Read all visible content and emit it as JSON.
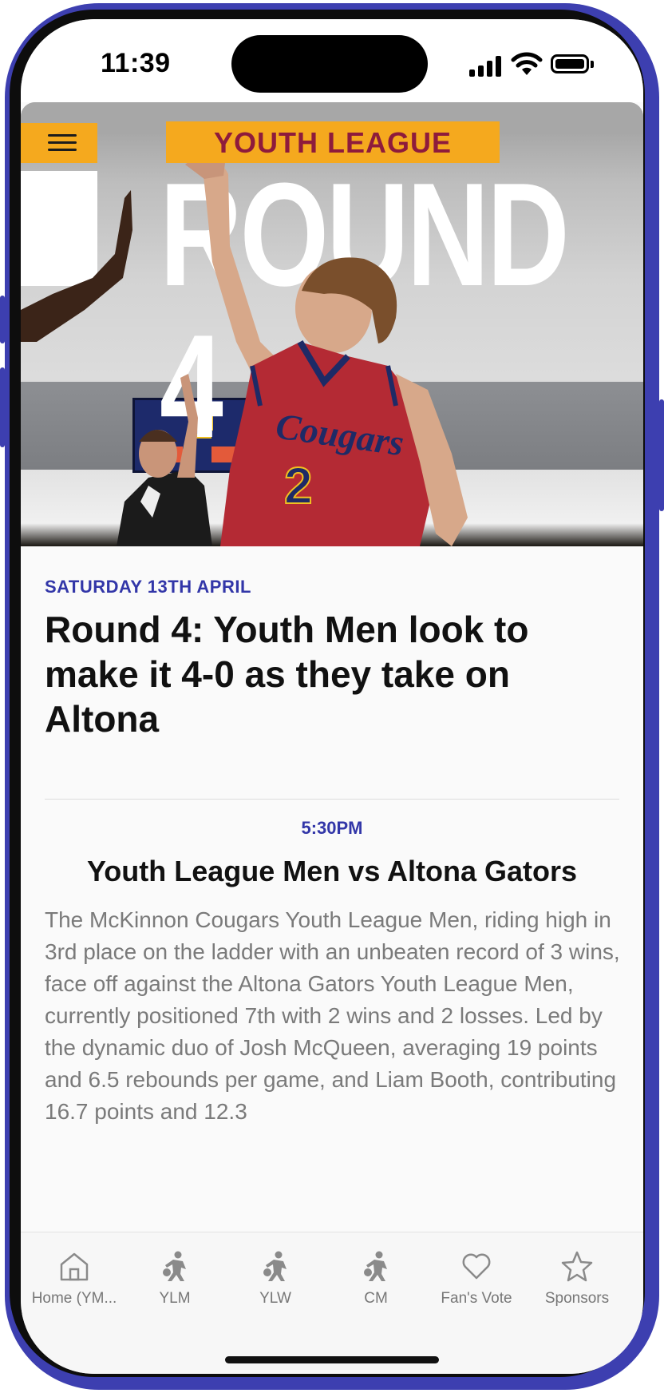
{
  "status_bar": {
    "time": "11:39"
  },
  "hero": {
    "banner_text": "YOUTH LEAGUE",
    "round_text": "ROUND 4",
    "jersey_text": "Cougars",
    "jersey_number": "2"
  },
  "article": {
    "date": "SATURDAY 13TH APRIL",
    "headline": "Round 4: Youth Men look to make it 4-0 as they take on Altona",
    "time": "5:30PM",
    "match_title": "Youth League Men vs Altona Gators",
    "body": "The McKinnon Cougars Youth League Men, riding high in 3rd place on the ladder with an unbeaten record of 3 wins, face off against the Altona Gators Youth League Men, currently positioned 7th with 2 wins and 2 losses. Led by the dynamic duo of Josh McQueen, averaging 19 points and 6.5 rebounds per game, and Liam Booth, contributing 16.7 points and 12.3"
  },
  "tabs": [
    {
      "label": "Home (YM...",
      "icon": "home-icon"
    },
    {
      "label": "YLM",
      "icon": "basketball-player-icon"
    },
    {
      "label": "YLW",
      "icon": "basketball-player-icon"
    },
    {
      "label": "CM",
      "icon": "basketball-player-icon"
    },
    {
      "label": "Fan's Vote",
      "icon": "heart-icon"
    },
    {
      "label": "Sponsors",
      "icon": "star-icon"
    }
  ],
  "colors": {
    "accent": "#3236a8",
    "banner_yellow": "#f5a91e",
    "banner_text": "#8e1b3c",
    "frame": "#3d3fb0"
  }
}
